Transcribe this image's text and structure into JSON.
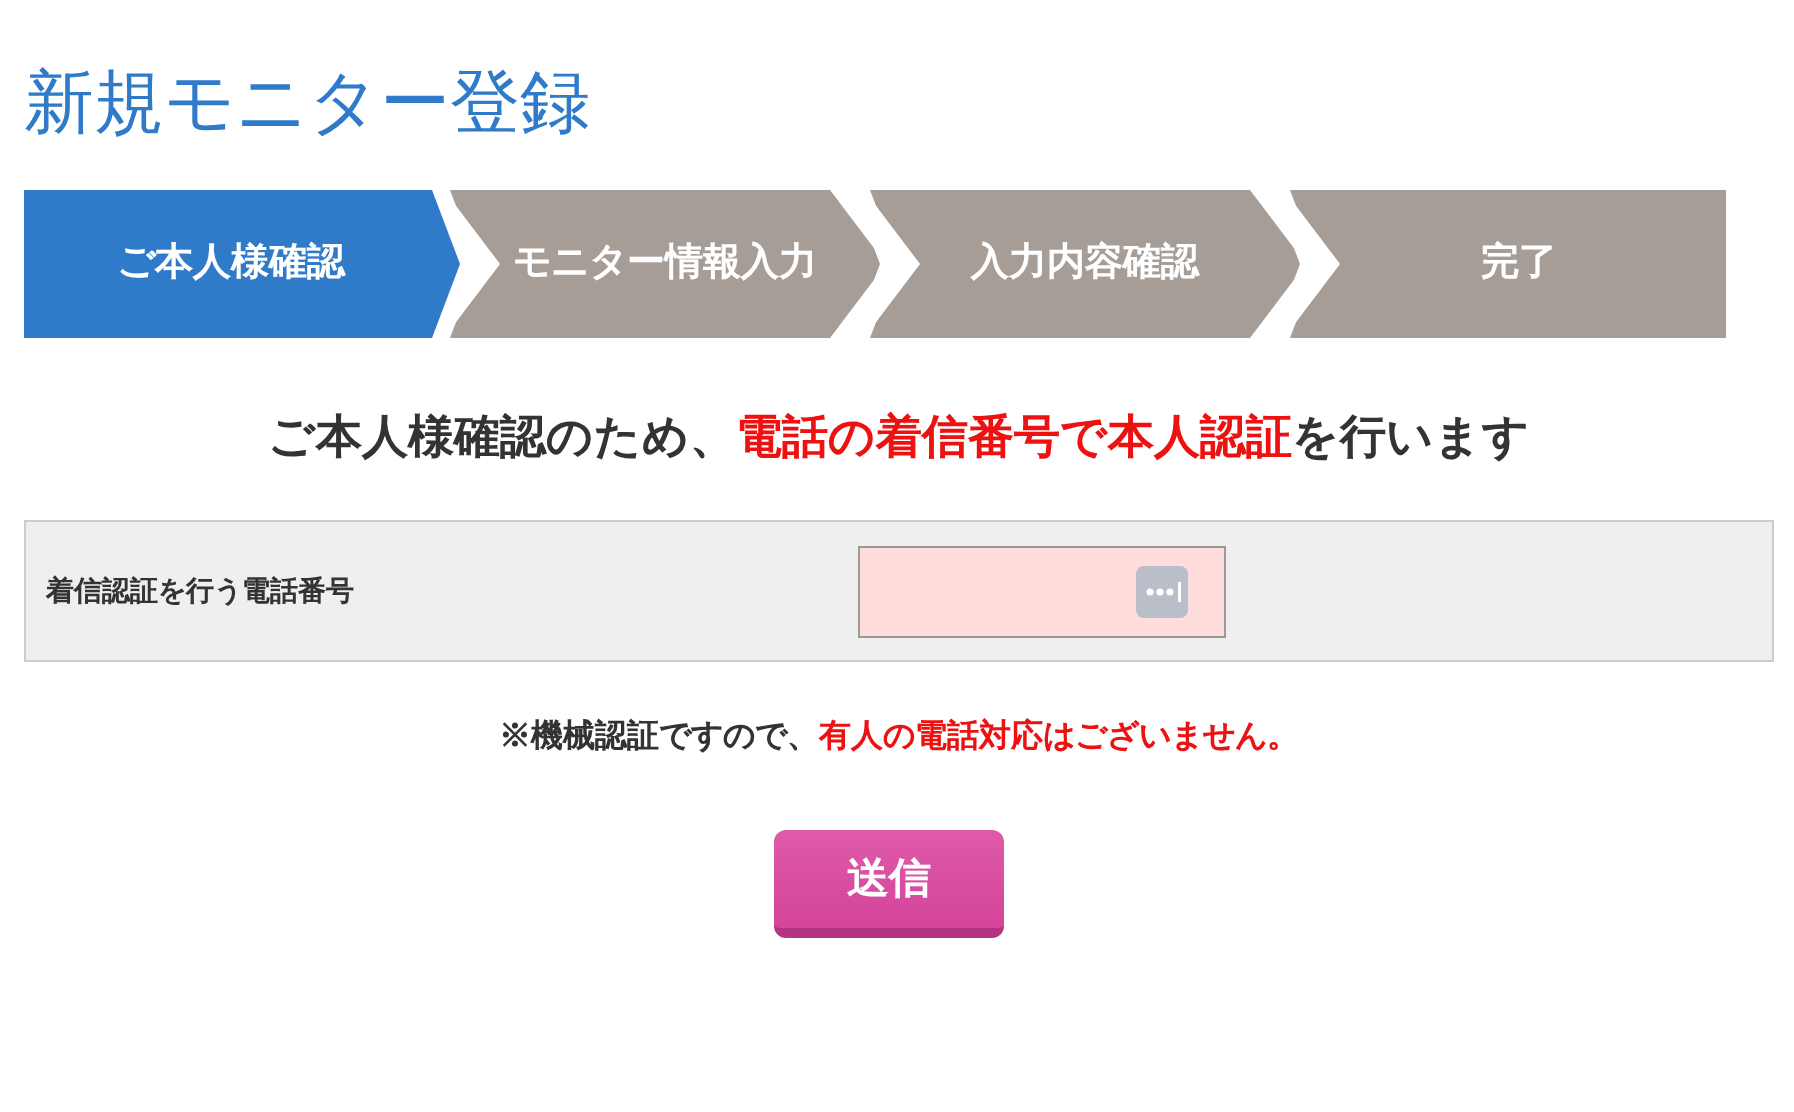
{
  "page_title": "新規モニター登録",
  "steps": [
    {
      "label": "ご本人様確認",
      "selected": true
    },
    {
      "label": "モニター情報入力",
      "selected": false
    },
    {
      "label": "入力内容確認",
      "selected": false
    },
    {
      "label": "完了",
      "selected": false
    }
  ],
  "heading": [
    {
      "text": "ご本人様確認のため、",
      "emphasis": false
    },
    {
      "text": "電話の着信番号で本人認証",
      "emphasis": true
    },
    {
      "text": "を行います",
      "emphasis": false
    }
  ],
  "form": {
    "label": "着信認証を行う電話番号"
  },
  "note": [
    {
      "text": "※機械認証ですので、",
      "emphasis": false
    },
    {
      "text": "有人の電話対応はございません。",
      "emphasis": true
    }
  ],
  "submit": "送信"
}
